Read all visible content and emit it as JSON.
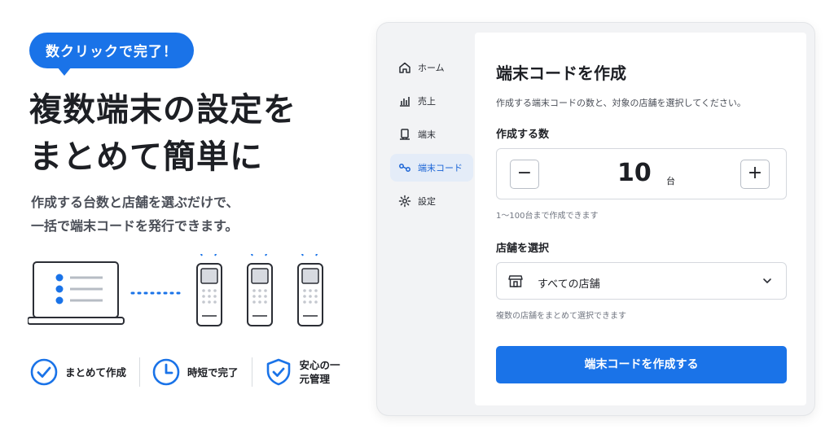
{
  "promo": {
    "badge": "数クリックで完了！",
    "headline_line1": "複数端末の設定を",
    "headline_line2": "まとめて簡単に",
    "sub_line1": "作成する台数と店舗を選ぶだけで、",
    "sub_line2": "一括で端末コードを発行できます。",
    "features": [
      {
        "label": "まとめて作成",
        "icon": "check-circle-icon"
      },
      {
        "label": "時短で完了",
        "icon": "clock-icon"
      },
      {
        "label": "安心の一元管理",
        "icon": "shield-check-icon"
      }
    ]
  },
  "sidebar": {
    "items": [
      {
        "label": "ホーム",
        "icon": "home-icon"
      },
      {
        "label": "売上",
        "icon": "bar-chart-icon"
      },
      {
        "label": "端末",
        "icon": "terminal-icon"
      },
      {
        "label": "端末コード",
        "icon": "link-icon",
        "active": true
      },
      {
        "label": "設定",
        "icon": "gear-icon"
      }
    ]
  },
  "main": {
    "title": "端末コードを作成",
    "description": "作成する端末コードの数と、対象の店舗を選択してください。",
    "quantity": {
      "label": "作成する数",
      "value": "10",
      "unit": "台",
      "minus": "−",
      "plus": "+",
      "hint": "1〜100台まで作成できます"
    },
    "store": {
      "label": "店舗を選択",
      "selected": "すべての店舗",
      "hint": "複数の店舗をまとめて選択できます"
    },
    "submit_label": "端末コードを作成する"
  },
  "colors": {
    "accent": "#1a73e8",
    "active_nav_bg": "#e4ecf8",
    "window_bg": "#f2f3f5"
  }
}
